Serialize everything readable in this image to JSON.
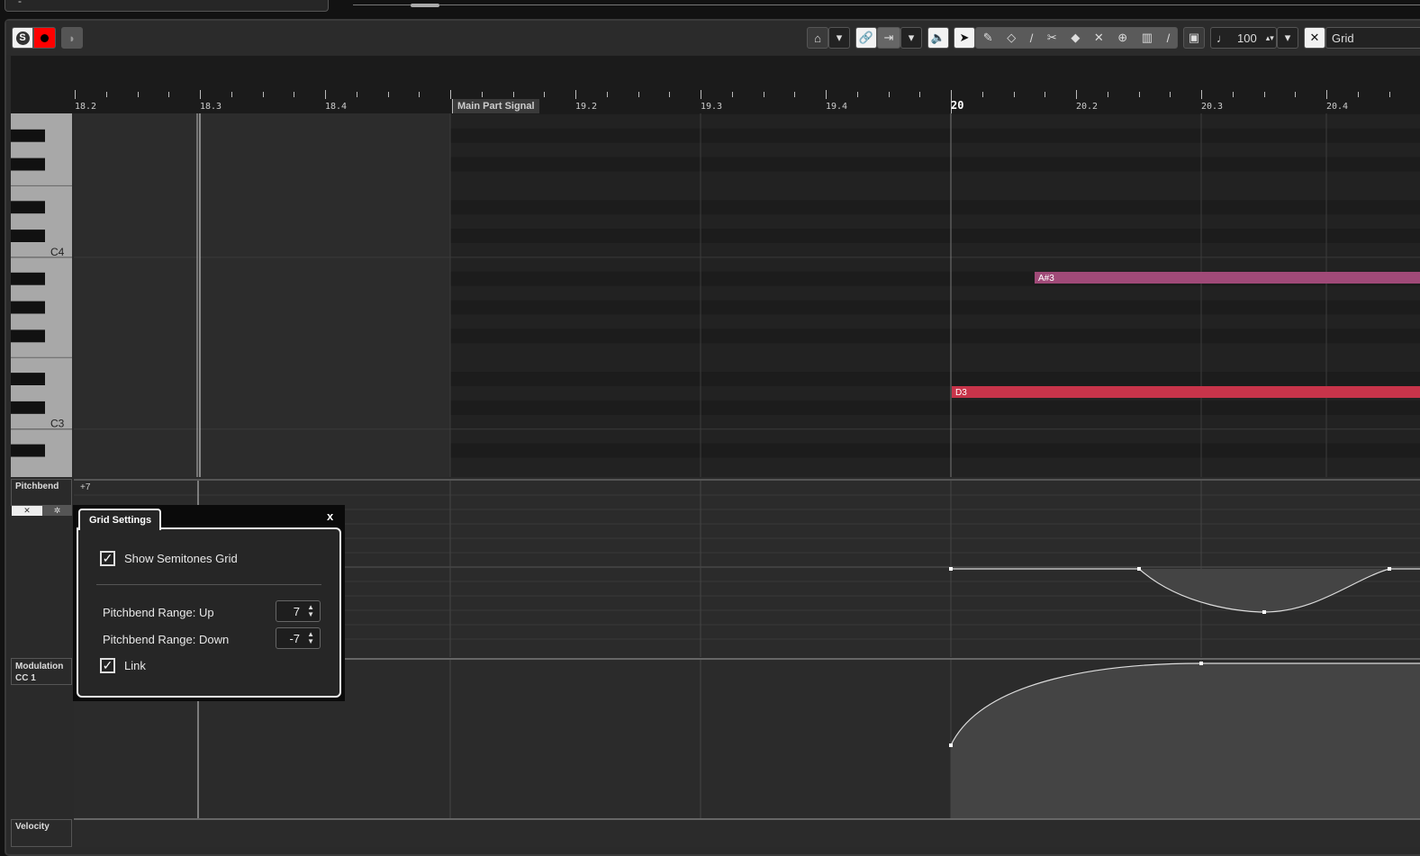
{
  "top": {
    "field_value": "-"
  },
  "toolbar": {
    "solo_label": "S",
    "velocity_value": "100",
    "snap_type": "Grid",
    "colors": {
      "record": "#ff0000"
    },
    "tools": [
      "auto-scroll-icon",
      "chevron-down-icon",
      "link-icon",
      "snap-icon",
      "chevron-down-icon",
      "acoustic-feedback-icon",
      "object-selection-icon",
      "draw-icon",
      "erase-icon",
      "trim-icon",
      "split-icon",
      "glue-icon",
      "mute-icon",
      "zoom-icon",
      "line-icon",
      "pencil-line-icon"
    ]
  },
  "ruler": {
    "labels": [
      "18.2",
      "18.3",
      "18.4",
      "",
      "19.2",
      "19.3",
      "19.4",
      "20",
      "20.2",
      "20.3",
      "20.4"
    ],
    "part_name": "Main Part Signal"
  },
  "keys": {
    "c4": "C4",
    "c3": "C3"
  },
  "notes": [
    {
      "name": "A#3",
      "color": "#a04a78"
    },
    {
      "name": "D3",
      "color": "#c8344a"
    }
  ],
  "lanes": {
    "pitchbend": "Pitchbend",
    "pitchbend_scale": "+7",
    "modulation": "Modulation",
    "modulation_cc": "CC 1",
    "velocity": "Velocity"
  },
  "dialog": {
    "title": "Grid Settings",
    "close": "x",
    "show_semitones": "Show Semitones Grid",
    "show_semitones_checked": true,
    "range_up_label": "Pitchbend Range: Up",
    "range_up": "7",
    "range_down_label": "Pitchbend Range: Down",
    "range_down": "-7",
    "link_label": "Link",
    "link_checked": true
  }
}
